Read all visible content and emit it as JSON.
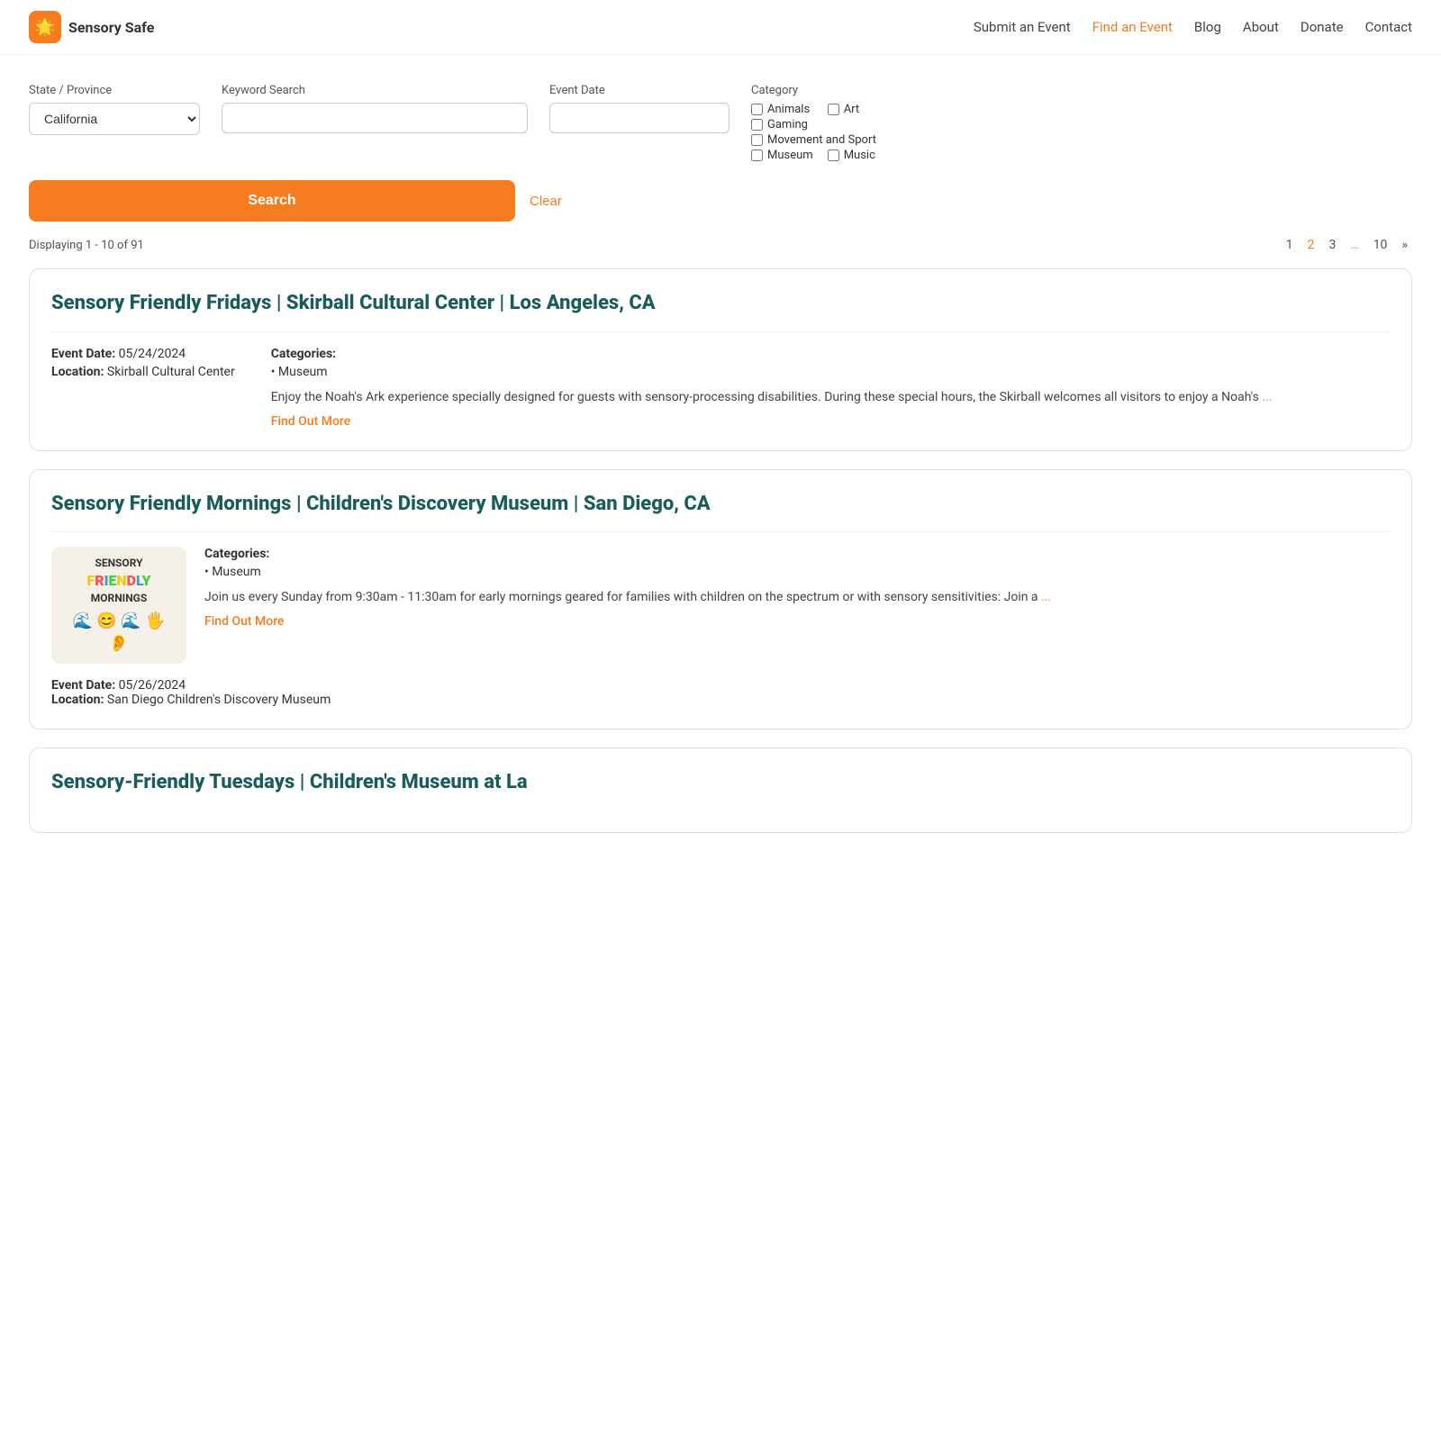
{
  "brand": {
    "name": "Sensory Safe",
    "icon": "🌟"
  },
  "nav": {
    "links": [
      {
        "id": "submit",
        "label": "Submit an Event",
        "active": false
      },
      {
        "id": "find",
        "label": "Find an Event",
        "active": true
      },
      {
        "id": "blog",
        "label": "Blog",
        "active": false
      },
      {
        "id": "about",
        "label": "About",
        "active": false
      },
      {
        "id": "donate",
        "label": "Donate",
        "active": false
      },
      {
        "id": "contact",
        "label": "Contact",
        "active": false
      }
    ]
  },
  "search": {
    "state_label": "State / Province",
    "state_value": "California",
    "keyword_label": "Keyword Search",
    "keyword_placeholder": "",
    "date_label": "Event Date",
    "date_placeholder": "",
    "category_label": "Category",
    "categories": [
      {
        "id": "animals",
        "label": "Animals",
        "checked": false
      },
      {
        "id": "art",
        "label": "Art",
        "checked": false
      },
      {
        "id": "gaming",
        "label": "Gaming",
        "checked": false
      },
      {
        "id": "movement",
        "label": "Movement and Sport",
        "checked": false
      },
      {
        "id": "museum",
        "label": "Museum",
        "checked": false
      },
      {
        "id": "music",
        "label": "Music",
        "checked": false
      }
    ],
    "search_button": "Search",
    "clear_button": "Clear"
  },
  "results": {
    "display_text": "Displaying 1 - 10 of 91",
    "pagination": {
      "pages": [
        "1",
        "2",
        "3",
        "...",
        "10"
      ],
      "active": "2",
      "next": "»"
    }
  },
  "events": [
    {
      "id": "event-1",
      "title": "Sensory Friendly Fridays | Skirball Cultural Center | Los Angeles, CA",
      "date_label": "Event Date:",
      "date_value": "05/24/2024",
      "location_label": "Location:",
      "location_value": "Skirball Cultural Center",
      "categories": [
        "Museum"
      ],
      "description": "Enjoy the Noah's Ark experience specially designed for guests with sensory-processing disabilities. During these special hours, the Skirball welcomes all visitors to enjoy a Noah's",
      "has_image": false,
      "find_more": "Find Out More"
    },
    {
      "id": "event-2",
      "title": "Sensory Friendly Mornings | Children's Discovery Museum | San Diego, CA",
      "date_label": "Event Date:",
      "date_value": "05/26/2024",
      "location_label": "Location:",
      "location_value": "San Diego Children's Discovery Museum",
      "categories": [
        "Museum"
      ],
      "description": "Join us every Sunday from 9:30am - 11:30am for early mornings geared for families with children on the spectrum or with sensory sensitivities: Join a",
      "has_image": true,
      "image_alt": "Sensory Friendly Mornings logo",
      "find_more": "Find Out More"
    },
    {
      "id": "event-3",
      "title": "Sensory-Friendly Tuesdays | Children's Museum at La",
      "date_label": "",
      "date_value": "",
      "location_label": "",
      "location_value": "",
      "categories": [],
      "description": "",
      "has_image": false,
      "find_more": ""
    }
  ]
}
